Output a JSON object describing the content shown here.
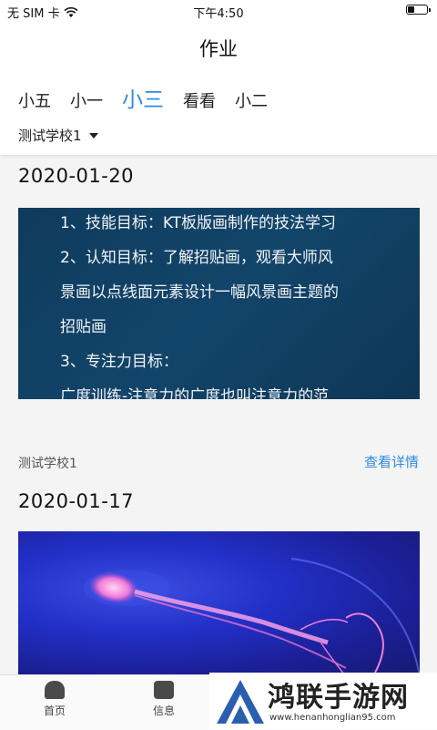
{
  "status_bar": {
    "carrier": "无 SIM 卡",
    "time": "下午4:50"
  },
  "header": {
    "title": "作业",
    "tabs": [
      "小五",
      "小一",
      "小三",
      "看看",
      "小二"
    ],
    "active_tab": 2,
    "school_filter": "测试学校1"
  },
  "feed": [
    {
      "date": "2020-01-20",
      "content_lines": [
        "1、技能目标：KT板版画制作的技法学习",
        "2、认知目标：了解招贴画，观看大师风",
        "景画以点线面元素设计一幅风景画主题的",
        "招贴画",
        "3、专注力目标：",
        "广度训练-注意力的广度也叫注意力的范"
      ],
      "school": "测试学校1",
      "detail_link": "查看详情"
    },
    {
      "date": "2020-01-17",
      "image": "jellyfish-photo"
    }
  ],
  "tabbar": {
    "items": [
      {
        "label": "首页",
        "icon": "home-icon"
      },
      {
        "label": "信息",
        "icon": "message-icon"
      }
    ]
  },
  "watermark": {
    "brand": "鸿联手游网",
    "url": "www.henanhonglian95.com"
  },
  "colors": {
    "accent": "#2f8be0",
    "note_bg": "#12456a"
  }
}
